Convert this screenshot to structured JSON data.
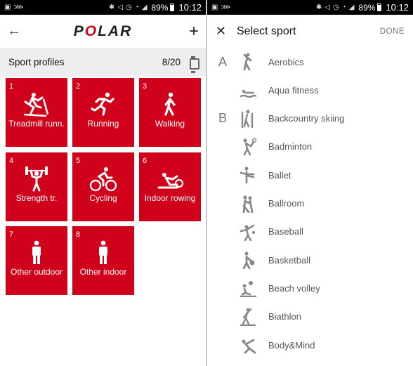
{
  "status_bar": {
    "battery": "89%",
    "time": "10:12"
  },
  "left": {
    "logo": "POLAR",
    "header_title": "Sport profiles",
    "count": "8/20",
    "tiles": [
      {
        "num": "1",
        "label": "Treadmill runn."
      },
      {
        "num": "2",
        "label": "Running"
      },
      {
        "num": "3",
        "label": "Walking"
      },
      {
        "num": "4",
        "label": "Strength tr."
      },
      {
        "num": "5",
        "label": "Cycling"
      },
      {
        "num": "6",
        "label": "Indoor rowing"
      },
      {
        "num": "7",
        "label": "Other outdoor"
      },
      {
        "num": "8",
        "label": "Other indoor"
      }
    ]
  },
  "right": {
    "title": "Select sport",
    "done_label": "DONE",
    "sports": [
      {
        "letter": "A",
        "name": "Aerobics",
        "icon": "aerobics-icon"
      },
      {
        "letter": "",
        "name": "Aqua fitness",
        "icon": "aqua-fitness-icon"
      },
      {
        "letter": "B",
        "name": "Backcountry skiing",
        "icon": "backcountry-skiing-icon"
      },
      {
        "letter": "",
        "name": "Badminton",
        "icon": "badminton-icon"
      },
      {
        "letter": "",
        "name": "Ballet",
        "icon": "ballet-icon"
      },
      {
        "letter": "",
        "name": "Ballroom",
        "icon": "ballroom-icon"
      },
      {
        "letter": "",
        "name": "Baseball",
        "icon": "baseball-icon"
      },
      {
        "letter": "",
        "name": "Basketball",
        "icon": "basketball-icon"
      },
      {
        "letter": "",
        "name": "Beach volley",
        "icon": "beach-volley-icon"
      },
      {
        "letter": "",
        "name": "Biathlon",
        "icon": "biathlon-icon"
      },
      {
        "letter": "",
        "name": "Body&Mind",
        "icon": "body-mind-icon"
      }
    ]
  },
  "colors": {
    "accent": "#d0021b"
  }
}
